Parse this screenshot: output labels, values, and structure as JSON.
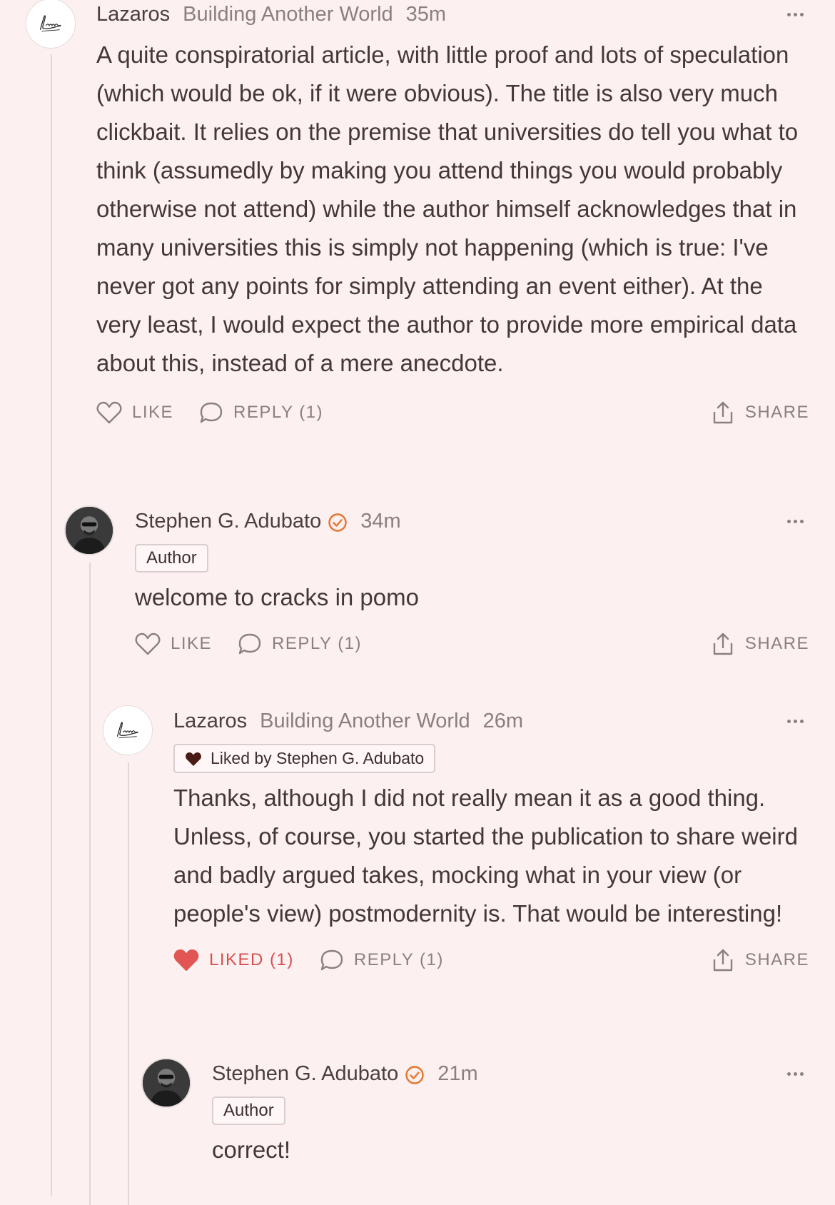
{
  "comments": [
    {
      "name": "Lazaros",
      "publication": "Building Another World",
      "time": "35m",
      "text": "A quite conspiratorial article, with little proof and lots of speculation (which would be ok, if it were obvious). The title is also very much clickbait. It relies on the premise that universities do tell you what to think (assumedly by making you attend things you would probably otherwise not attend) while the author himself acknowledges that in many universities this is simply not happening (which is true: I've never got any points for simply attending an event either). At the very least, I would expect the author to provide more empirical data about this, instead of a mere anecdote.",
      "like_label": "LIKE",
      "reply_label": "REPLY (1)",
      "share_label": "SHARE"
    },
    {
      "name": "Stephen G. Adubato",
      "time": "34m",
      "badge": "Author",
      "text": "welcome to cracks in pomo",
      "like_label": "LIKE",
      "reply_label": "REPLY (1)",
      "share_label": "SHARE"
    },
    {
      "name": "Lazaros",
      "publication": "Building Another World",
      "time": "26m",
      "liked_by": "Liked by Stephen G. Adubato",
      "text": "Thanks, although I did not really mean it as a good thing. Unless, of course, you started the publication to share weird and badly argued takes, mocking what in your view (or people's view) postmodernity is. That would be interesting!",
      "like_label": "LIKED (1)",
      "reply_label": "REPLY (1)",
      "share_label": "SHARE"
    },
    {
      "name": "Stephen G. Adubato",
      "time": "21m",
      "badge": "Author",
      "text": "correct!"
    }
  ],
  "colors": {
    "background": "#fdf0f0",
    "verified": "#e8742a",
    "liked": "#d94f4f",
    "muted": "#8a8080"
  }
}
